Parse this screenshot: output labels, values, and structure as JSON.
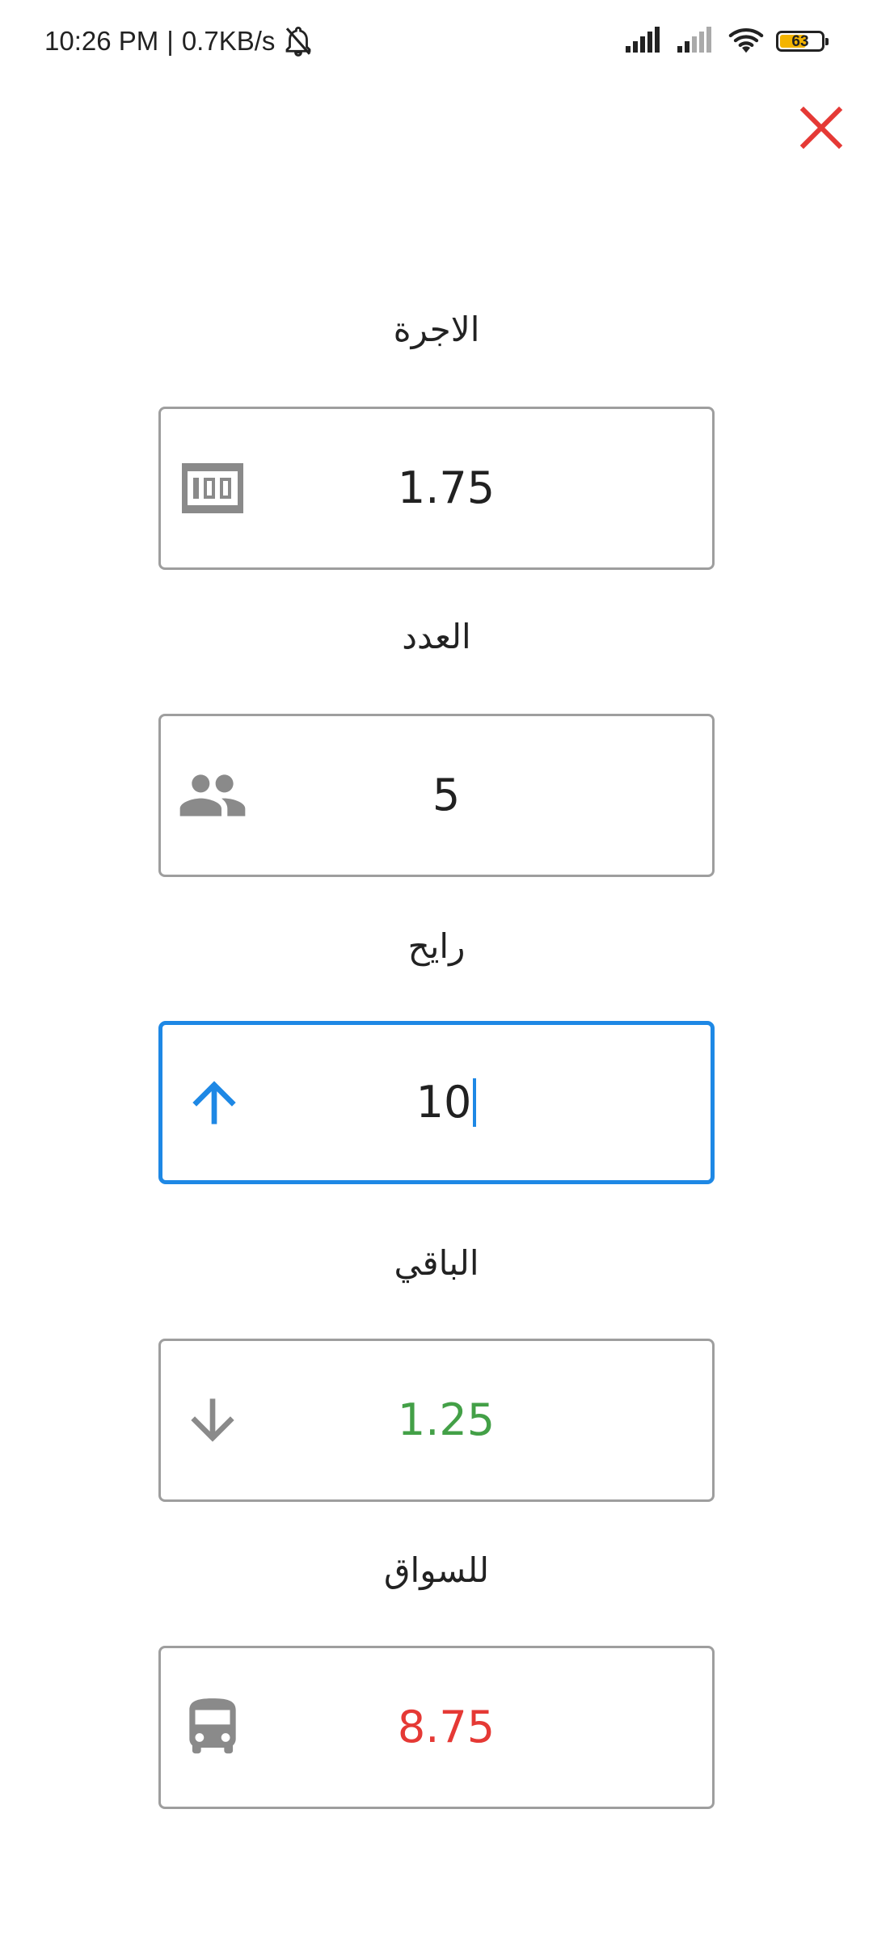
{
  "status_bar": {
    "time": "10:26 PM",
    "separator": "|",
    "net_speed": "0.7KB/s",
    "battery_level": "63",
    "battery_fraction": 0.63,
    "icons": [
      "bell-off-icon",
      "cell-signal-icon",
      "cell-signal-icon",
      "wifi-icon",
      "battery-icon"
    ]
  },
  "close_icon": "close-icon",
  "colors": {
    "accent": "#1e88e5",
    "close": "#e53935",
    "border": "#9e9e9e",
    "icon_gray": "#8a8a8a",
    "value_default": "#212121",
    "value_green": "#43a047",
    "value_red": "#e53935",
    "battery": "#f4b400"
  },
  "fields": [
    {
      "key": "fare",
      "label": "الاجرة",
      "value": "1.75",
      "icon": "money-icon",
      "color": "#212121",
      "focused": false
    },
    {
      "key": "count",
      "label": "العدد",
      "value": "5",
      "icon": "people-icon",
      "color": "#212121",
      "focused": false
    },
    {
      "key": "paid",
      "label": "رايح",
      "value": "10",
      "icon": "arrow-up-icon",
      "color": "#212121",
      "focused": true
    },
    {
      "key": "change",
      "label": "الباقي",
      "value": "1.25",
      "icon": "arrow-down-icon",
      "color": "#43a047",
      "focused": false
    },
    {
      "key": "driver",
      "label": "للسواق",
      "value": "8.75",
      "icon": "bus-icon",
      "color": "#e53935",
      "focused": false
    }
  ]
}
